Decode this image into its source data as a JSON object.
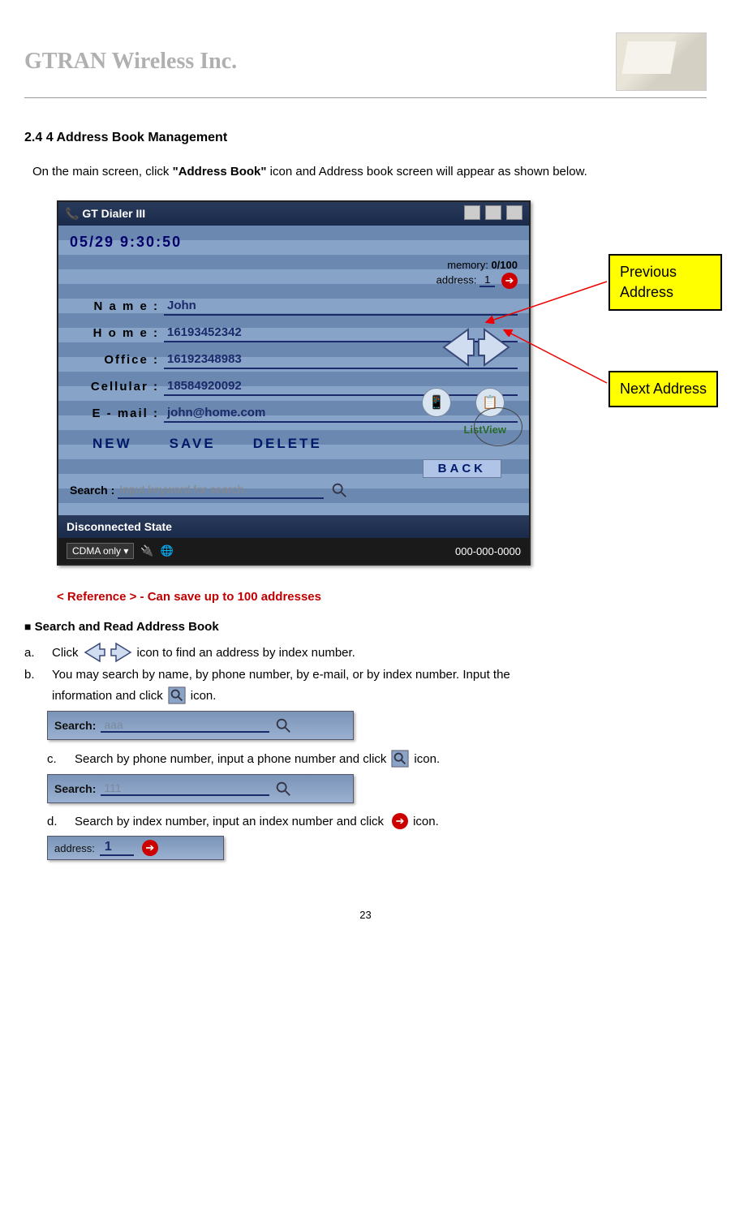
{
  "header": {
    "company": "GTRAN Wireless Inc."
  },
  "section": {
    "number_title": "2.4 4 Address Book Management"
  },
  "intro": {
    "pre": "On the main screen, click ",
    "bold": "\"Address Book\"",
    "post": " icon and Address book screen will appear as shown below."
  },
  "app": {
    "title": "GT Dialer III",
    "datetime": "05/29    9:30:50",
    "memory_label": "memory:",
    "memory_value": "0/100",
    "address_label": "address:",
    "address_value": "1",
    "fields": {
      "name_label": "N a m e :",
      "name_value": "John",
      "home_label": "H o m e :",
      "home_value": "16193452342",
      "office_label": "Office   :",
      "office_value": "16192348983",
      "cellular_label": "Cellular :",
      "cellular_value": "18584920092",
      "email_label": "E - mail :",
      "email_value": "john@home.com"
    },
    "listview_label": "ListView",
    "buttons": {
      "new": "NEW",
      "save": "SAVE",
      "delete": "DELETE",
      "back": "BACK"
    },
    "search_label": "Search :",
    "search_placeholder": "Input keyword for search.",
    "status": "Disconnected State",
    "mode": "CDMA only",
    "phone_display": "000-000-0000"
  },
  "callouts": {
    "previous": "Previous Address",
    "next": "Next Address"
  },
  "reference": "< Reference > - Can save up to 100 addresses",
  "search_section": {
    "heading": "Search and Read Address Book",
    "a_pre": "Click",
    "a_post": "icon to find an address by index number.",
    "b_line1": "You may search by name, by phone number, by e-mail, or by index number. Input the",
    "b_line2_pre": "information and click",
    "b_line2_post": "icon.",
    "example1_label": "Search:",
    "example1_value": "aaa",
    "c_pre": "Search by phone number, input a phone number and click",
    "c_post": "icon.",
    "example2_label": "Search:",
    "example2_value": "111",
    "d_pre": "Search by index number, input an index number and click",
    "d_post": "icon.",
    "example3_label": "address:",
    "example3_value": "1"
  },
  "markers": {
    "a": "a.",
    "b": "b.",
    "c": "c.",
    "d": "d."
  },
  "page_number": "23"
}
